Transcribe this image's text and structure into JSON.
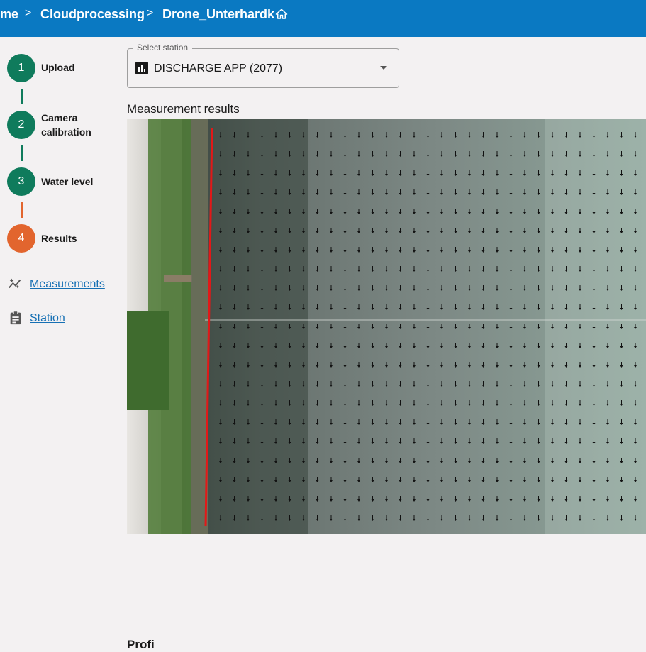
{
  "breadcrumb": {
    "items": [
      "me",
      "Cloudprocessing",
      "Drone_Unterhardk"
    ],
    "separator": ">"
  },
  "stepper": {
    "steps": [
      {
        "number": "1",
        "label": "Upload",
        "status": "completed"
      },
      {
        "number": "2",
        "label": "Camera calibration",
        "status": "completed"
      },
      {
        "number": "3",
        "label": "Water level",
        "status": "completed"
      },
      {
        "number": "4",
        "label": "Results",
        "status": "active"
      }
    ]
  },
  "sidebar": {
    "links": [
      {
        "label": "Measurements",
        "icon": "auto-graph-icon"
      },
      {
        "label": "Station",
        "icon": "clipboard-icon"
      }
    ]
  },
  "station_select": {
    "label": "Select station",
    "value": "DISCHARGE APP (2077)",
    "icon": "bar-chart-icon"
  },
  "results": {
    "title": "Measurement results",
    "image_alt": "Drone image of river bank with velocity vectors and red bank line"
  },
  "profile": {
    "heading": "Profi"
  },
  "colors": {
    "topbar": "#0a79c2",
    "step_completed": "#0f7b5c",
    "step_active": "#e2652e",
    "link": "#1670b4",
    "bank_line": "#e21818"
  }
}
